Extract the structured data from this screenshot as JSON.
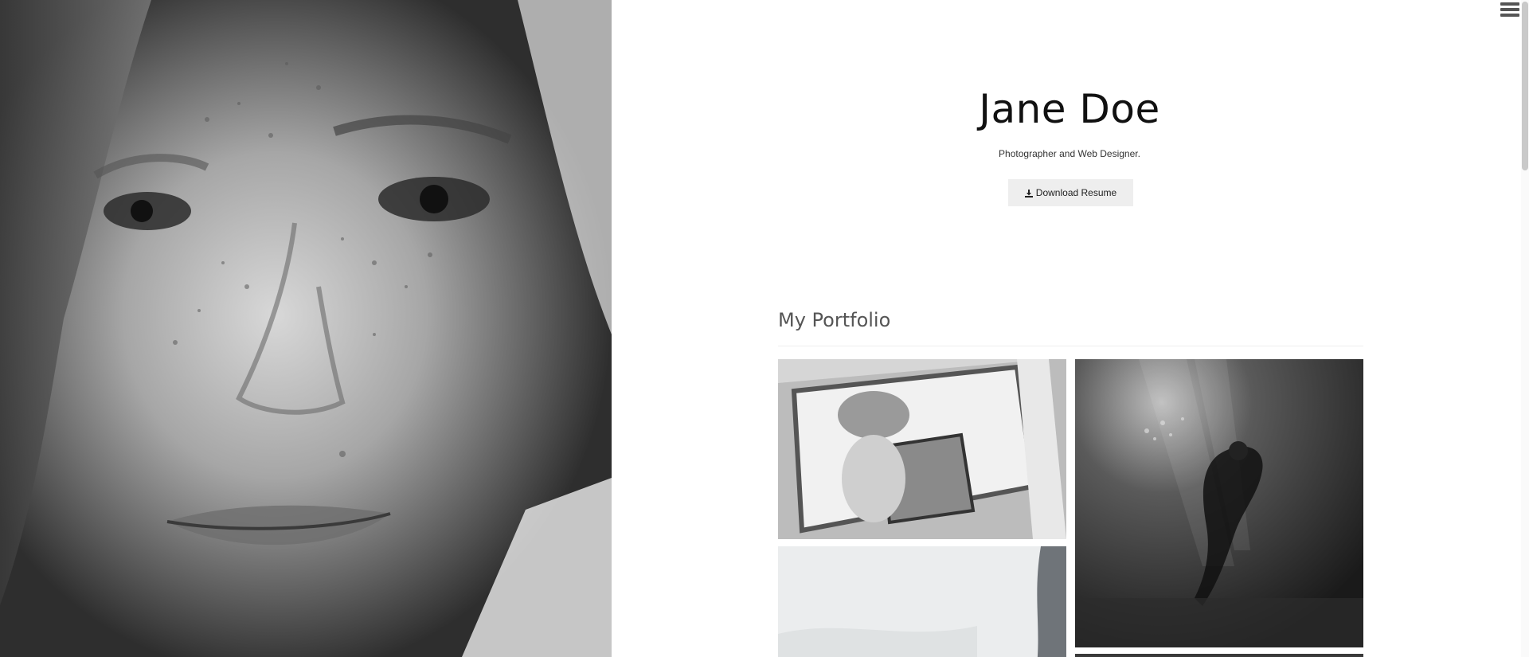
{
  "profile": {
    "name": "Jane Doe",
    "tagline": "Photographer and Web Designer.",
    "resume_button_label": "Download Resume"
  },
  "portfolio": {
    "heading": "My Portfolio",
    "tiles": [
      {
        "subject": "couple in vintage car"
      },
      {
        "subject": "underwater figure"
      },
      {
        "subject": "misty cliff"
      },
      {
        "subject": "image"
      }
    ]
  },
  "icons": {
    "menu": "hamburger-menu-icon",
    "download": "download-icon"
  },
  "colors": {
    "background": "#ffffff",
    "button_bg": "#eeeeee",
    "heading_text": "#555555"
  }
}
